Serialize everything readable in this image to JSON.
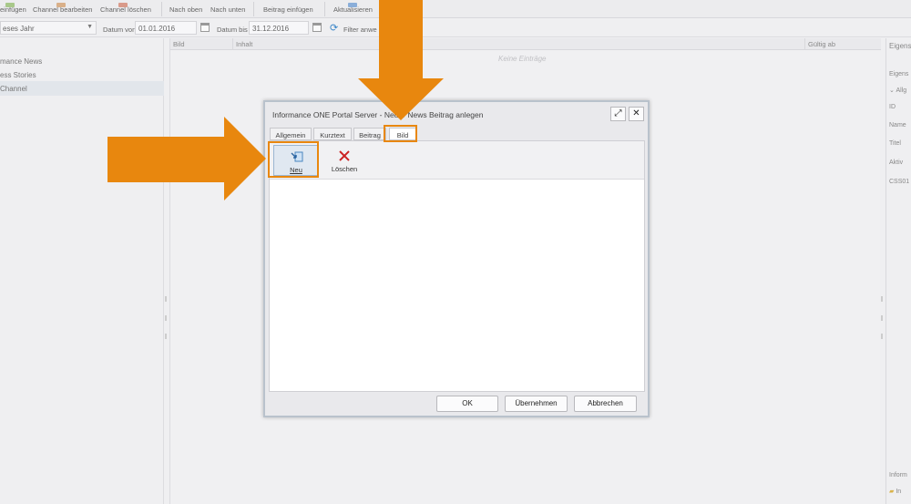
{
  "toolbar": {
    "items": [
      "einfügen",
      "Channel bearbeiten",
      "Channel löschen",
      "Nach oben",
      "Nach unten",
      "Beitrag einfügen",
      "Aktualisieren"
    ]
  },
  "filter": {
    "period": "eses Jahr",
    "date_from_label": "Datum von",
    "date_from": "01.01.2016",
    "date_to_label": "Datum bis",
    "date_to": "31.12.2016",
    "filter_label": "Filter anwe"
  },
  "channels": [
    "mance News",
    "ess Stories",
    "Channel"
  ],
  "grid": {
    "columns": [
      "Bild",
      "Inhalt",
      "Gültig ab"
    ],
    "empty_text": "Keine Einträge"
  },
  "properties": {
    "header": "Eigens",
    "subheader": "Eigens",
    "group": "Allg",
    "fields": [
      "ID",
      "Name",
      "Titel",
      "Aktiv",
      "CSS01"
    ],
    "footer_header": "Inform",
    "footer_item": "In"
  },
  "dialog": {
    "title": "Informance ONE Portal Server - Neuer News Beitrag anlegen",
    "tabs": [
      "Allgemein",
      "Kurztext",
      "Beitrag",
      "Bild"
    ],
    "active_tab": "Bild",
    "actions": {
      "new": "Neu",
      "delete": "Löschen"
    },
    "buttons": {
      "ok": "OK",
      "apply": "Übernehmen",
      "cancel": "Abbrechen"
    }
  },
  "colors": {
    "highlight": "#e8870e",
    "accent": "#3a86c8",
    "delete": "#cc2222"
  }
}
